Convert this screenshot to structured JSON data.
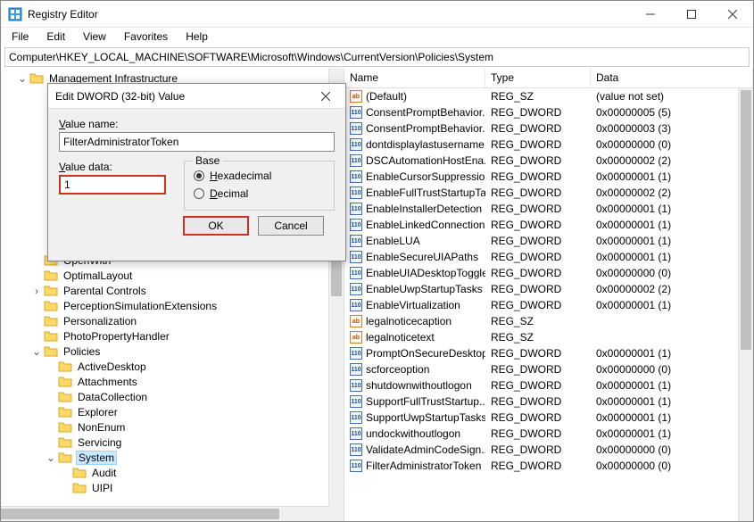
{
  "window": {
    "title": "Registry Editor"
  },
  "menubar": [
    "File",
    "Edit",
    "View",
    "Favorites",
    "Help"
  ],
  "address": "Computer\\HKEY_LOCAL_MACHINE\\SOFTWARE\\Microsoft\\Windows\\CurrentVersion\\Policies\\System",
  "tree": [
    {
      "depth": 1,
      "expander": "v",
      "label": "Management Infrastructure"
    },
    {
      "depth": 10,
      "expander": "",
      "label": ""
    },
    {
      "depth": 10,
      "expander": "",
      "label": ""
    },
    {
      "depth": 10,
      "expander": "",
      "label": ""
    },
    {
      "depth": 10,
      "expander": "",
      "label": ""
    },
    {
      "depth": 10,
      "expander": "",
      "label": ""
    },
    {
      "depth": 10,
      "expander": "",
      "label": ""
    },
    {
      "depth": 10,
      "expander": "",
      "label": ""
    },
    {
      "depth": 10,
      "expander": "",
      "label": ""
    },
    {
      "depth": 10,
      "expander": "",
      "label": ""
    },
    {
      "depth": 10,
      "expander": "",
      "label": ""
    },
    {
      "depth": 10,
      "expander": "",
      "label": ""
    },
    {
      "depth": 2,
      "expander": "",
      "label": "OpenWith"
    },
    {
      "depth": 2,
      "expander": "",
      "label": "OptimalLayout"
    },
    {
      "depth": 2,
      "expander": ">",
      "label": "Parental Controls"
    },
    {
      "depth": 2,
      "expander": "",
      "label": "PerceptionSimulationExtensions"
    },
    {
      "depth": 2,
      "expander": "",
      "label": "Personalization"
    },
    {
      "depth": 2,
      "expander": "",
      "label": "PhotoPropertyHandler"
    },
    {
      "depth": 2,
      "expander": "v",
      "label": "Policies"
    },
    {
      "depth": 3,
      "expander": "",
      "label": "ActiveDesktop"
    },
    {
      "depth": 3,
      "expander": "",
      "label": "Attachments"
    },
    {
      "depth": 3,
      "expander": "",
      "label": "DataCollection"
    },
    {
      "depth": 3,
      "expander": "",
      "label": "Explorer"
    },
    {
      "depth": 3,
      "expander": "",
      "label": "NonEnum"
    },
    {
      "depth": 3,
      "expander": "",
      "label": "Servicing"
    },
    {
      "depth": 3,
      "expander": "v",
      "label": "System",
      "selected": true
    },
    {
      "depth": 4,
      "expander": "",
      "label": "Audit"
    },
    {
      "depth": 4,
      "expander": "",
      "label": "UIPI"
    }
  ],
  "columns": {
    "name": "Name",
    "type": "Type",
    "data": "Data"
  },
  "values": [
    {
      "name": "(Default)",
      "type": "REG_SZ",
      "data": "(value not set)",
      "icon": "sz"
    },
    {
      "name": "ConsentPromptBehavior...",
      "type": "REG_DWORD",
      "data": "0x00000005 (5)",
      "icon": "dw"
    },
    {
      "name": "ConsentPromptBehavior...",
      "type": "REG_DWORD",
      "data": "0x00000003 (3)",
      "icon": "dw"
    },
    {
      "name": "dontdisplaylastusername",
      "type": "REG_DWORD",
      "data": "0x00000000 (0)",
      "icon": "dw"
    },
    {
      "name": "DSCAutomationHostEna...",
      "type": "REG_DWORD",
      "data": "0x00000002 (2)",
      "icon": "dw"
    },
    {
      "name": "EnableCursorSuppression",
      "type": "REG_DWORD",
      "data": "0x00000001 (1)",
      "icon": "dw"
    },
    {
      "name": "EnableFullTrustStartupTa...",
      "type": "REG_DWORD",
      "data": "0x00000002 (2)",
      "icon": "dw"
    },
    {
      "name": "EnableInstallerDetection",
      "type": "REG_DWORD",
      "data": "0x00000001 (1)",
      "icon": "dw"
    },
    {
      "name": "EnableLinkedConnections",
      "type": "REG_DWORD",
      "data": "0x00000001 (1)",
      "icon": "dw"
    },
    {
      "name": "EnableLUA",
      "type": "REG_DWORD",
      "data": "0x00000001 (1)",
      "icon": "dw"
    },
    {
      "name": "EnableSecureUIAPaths",
      "type": "REG_DWORD",
      "data": "0x00000001 (1)",
      "icon": "dw"
    },
    {
      "name": "EnableUIADesktopToggle",
      "type": "REG_DWORD",
      "data": "0x00000000 (0)",
      "icon": "dw"
    },
    {
      "name": "EnableUwpStartupTasks",
      "type": "REG_DWORD",
      "data": "0x00000002 (2)",
      "icon": "dw"
    },
    {
      "name": "EnableVirtualization",
      "type": "REG_DWORD",
      "data": "0x00000001 (1)",
      "icon": "dw"
    },
    {
      "name": "legalnoticecaption",
      "type": "REG_SZ",
      "data": "",
      "icon": "sz"
    },
    {
      "name": "legalnoticetext",
      "type": "REG_SZ",
      "data": "",
      "icon": "sz"
    },
    {
      "name": "PromptOnSecureDesktop",
      "type": "REG_DWORD",
      "data": "0x00000001 (1)",
      "icon": "dw"
    },
    {
      "name": "scforceoption",
      "type": "REG_DWORD",
      "data": "0x00000000 (0)",
      "icon": "dw"
    },
    {
      "name": "shutdownwithoutlogon",
      "type": "REG_DWORD",
      "data": "0x00000001 (1)",
      "icon": "dw"
    },
    {
      "name": "SupportFullTrustStartup...",
      "type": "REG_DWORD",
      "data": "0x00000001 (1)",
      "icon": "dw"
    },
    {
      "name": "SupportUwpStartupTasks",
      "type": "REG_DWORD",
      "data": "0x00000001 (1)",
      "icon": "dw"
    },
    {
      "name": "undockwithoutlogon",
      "type": "REG_DWORD",
      "data": "0x00000001 (1)",
      "icon": "dw"
    },
    {
      "name": "ValidateAdminCodeSign...",
      "type": "REG_DWORD",
      "data": "0x00000000 (0)",
      "icon": "dw"
    },
    {
      "name": "FilterAdministratorToken",
      "type": "REG_DWORD",
      "data": "0x00000000 (0)",
      "icon": "dw"
    }
  ],
  "dialog": {
    "title": "Edit DWORD (32-bit) Value",
    "value_name_label": "Value name:",
    "value_name": "FilterAdministratorToken",
    "value_data_label": "Value data:",
    "value_data": "1",
    "base_label": "Base",
    "radio_hex": "Hexadecimal",
    "radio_dec": "Decimal",
    "ok": "OK",
    "cancel": "Cancel"
  }
}
